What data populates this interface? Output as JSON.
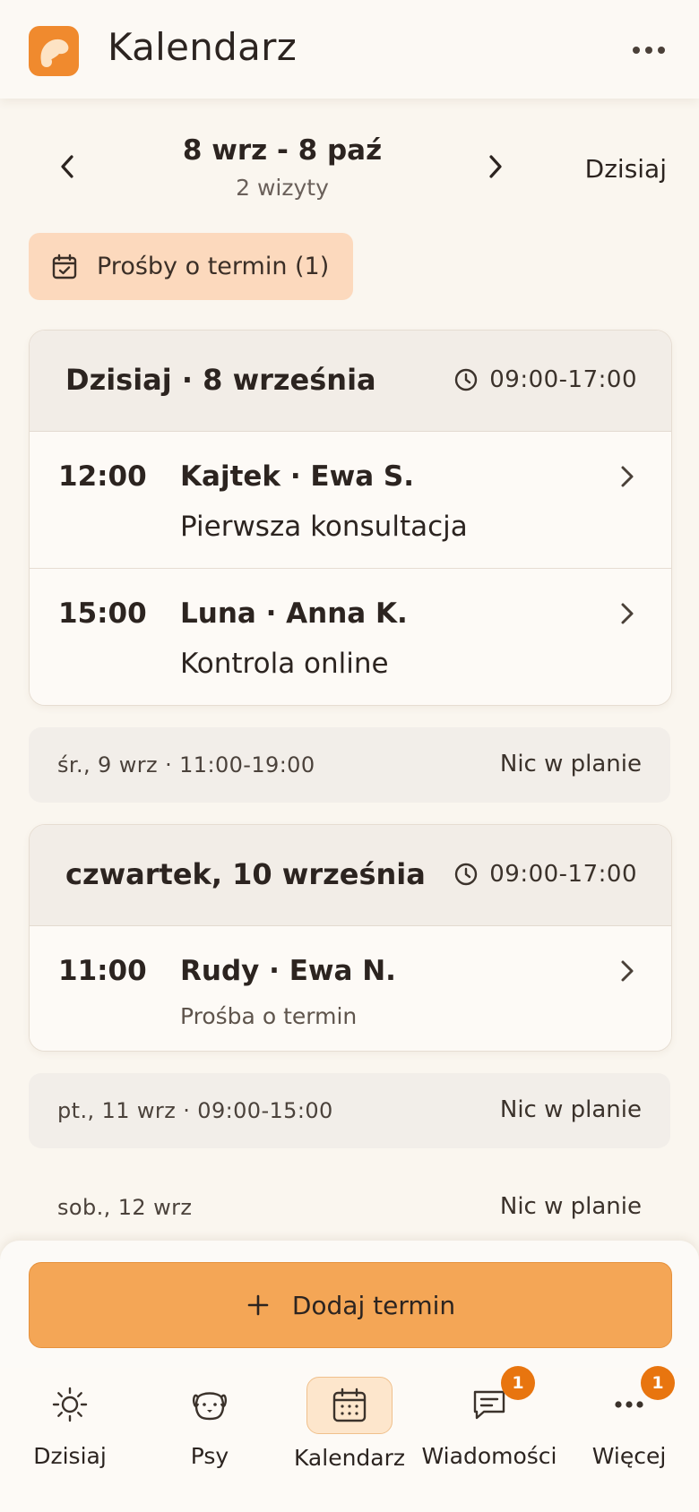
{
  "header": {
    "title": "Kalendarz"
  },
  "range": {
    "title": "8 wrz - 8 paź",
    "subtitle": "2 wizyty",
    "today_label": "Dzisiaj"
  },
  "requests_button": {
    "label": "Prośby o termin (1)"
  },
  "days": [
    {
      "title": "Dzisiaj · 8 września",
      "hours": "09:00-17:00",
      "appointments": [
        {
          "time": "12:00",
          "who": "Kajtek · Ewa S.",
          "what": "Pierwsza konsultacja"
        },
        {
          "time": "15:00",
          "who": "Luna · Anna K.",
          "what": "Kontrola online"
        }
      ]
    },
    {
      "title": "czwartek, 10 września",
      "hours": "09:00-17:00",
      "appointments": [
        {
          "time": "11:00",
          "who": "Rudy · Ewa N.",
          "what": "Prośba o termin"
        }
      ]
    }
  ],
  "empty_days": [
    {
      "date": "śr., 9 wrz · 11:00-19:00",
      "note": "Nic w planie"
    },
    {
      "date": "pt., 11 wrz · 09:00-15:00",
      "note": "Nic w planie"
    },
    {
      "date": "sob., 12 wrz",
      "note": "Nic w planie"
    }
  ],
  "add_button": {
    "label": "Dodaj termin"
  },
  "tabs": [
    {
      "label": "Dzisiaj",
      "icon": "sun-icon"
    },
    {
      "label": "Psy",
      "icon": "dog-icon"
    },
    {
      "label": "Kalendarz",
      "icon": "calendar-icon",
      "active": true
    },
    {
      "label": "Wiadomości",
      "icon": "message-icon",
      "badge": "1"
    },
    {
      "label": "Więcej",
      "icon": "more-icon",
      "badge": "1"
    }
  ],
  "colors": {
    "accent": "#f4a656",
    "badge": "#e8750f",
    "request_bg": "#fcd9bd",
    "background": "#faf6ef"
  }
}
